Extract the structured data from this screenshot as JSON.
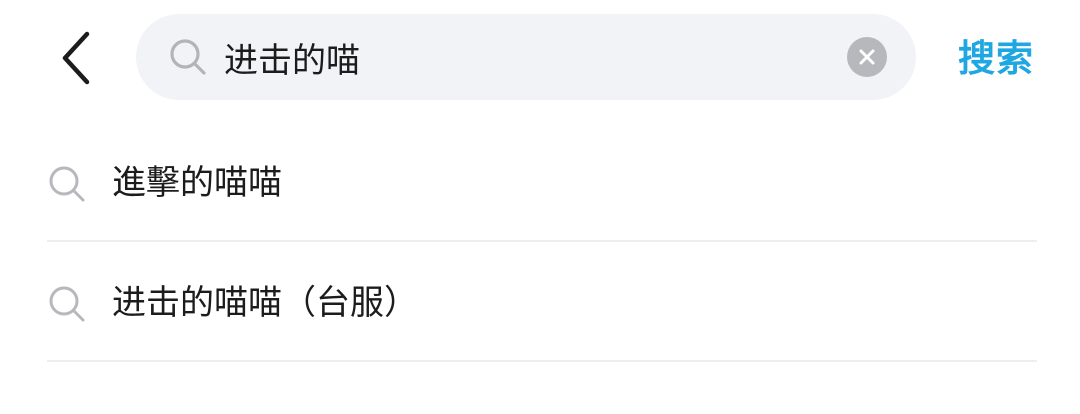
{
  "header": {
    "back_icon": "chevron-left-icon",
    "search": {
      "value": "进击的喵",
      "icon": "search-icon",
      "clear_icon": "close-circle-icon"
    },
    "search_button_label": "搜索"
  },
  "suggestions": [
    {
      "label": "進擊的喵喵",
      "icon": "search-icon"
    },
    {
      "label": "进击的喵喵（台服）",
      "icon": "search-icon"
    }
  ],
  "colors": {
    "accent": "#1ea7e1",
    "search_bg": "#f2f3f7",
    "text": "#1c1c1c",
    "icon_gray": "#b7b8bd",
    "divider": "#eeeeee"
  }
}
